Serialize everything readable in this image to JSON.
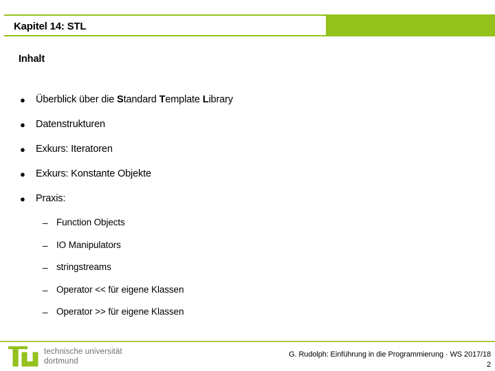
{
  "slide": {
    "title": "Kapitel 14: STL",
    "section_heading": "Inhalt"
  },
  "colors": {
    "accent_green": "#94C11C",
    "rule_green": "#AFCB3F",
    "logo_gray": "#6E6E6E"
  },
  "bullets": [
    {
      "marker": "●",
      "parts": [
        {
          "text": "Überblick über die ",
          "bold": false
        },
        {
          "text": "S",
          "bold": true
        },
        {
          "text": "tandard ",
          "bold": false
        },
        {
          "text": "T",
          "bold": true
        },
        {
          "text": "emplate ",
          "bold": false
        },
        {
          "text": "L",
          "bold": true
        },
        {
          "text": "ibrary",
          "bold": false
        }
      ],
      "plain": "Überblick über die Standard Template Library"
    },
    {
      "marker": "●",
      "plain": "Datenstrukturen"
    },
    {
      "marker": "●",
      "plain": "Exkurs: Iteratoren"
    },
    {
      "marker": "●",
      "plain": "Exkurs: Konstante Objekte"
    },
    {
      "marker": "●",
      "plain": "Praxis:"
    }
  ],
  "sub_bullets": [
    {
      "marker": "–",
      "label": "Function Objects"
    },
    {
      "marker": "–",
      "label": "IO Manipulators"
    },
    {
      "marker": "–",
      "label": "stringstreams"
    },
    {
      "marker": "–",
      "label": "Operator << für eigene Klassen"
    },
    {
      "marker": "–",
      "label": "Operator >> für eigene Klassen"
    }
  ],
  "logo": {
    "line1": "technische universität",
    "line2": "dortmund"
  },
  "footer": {
    "credit": "G. Rudolph: Einführung in die Programmierung · WS 2017/18",
    "page_number": "2"
  }
}
